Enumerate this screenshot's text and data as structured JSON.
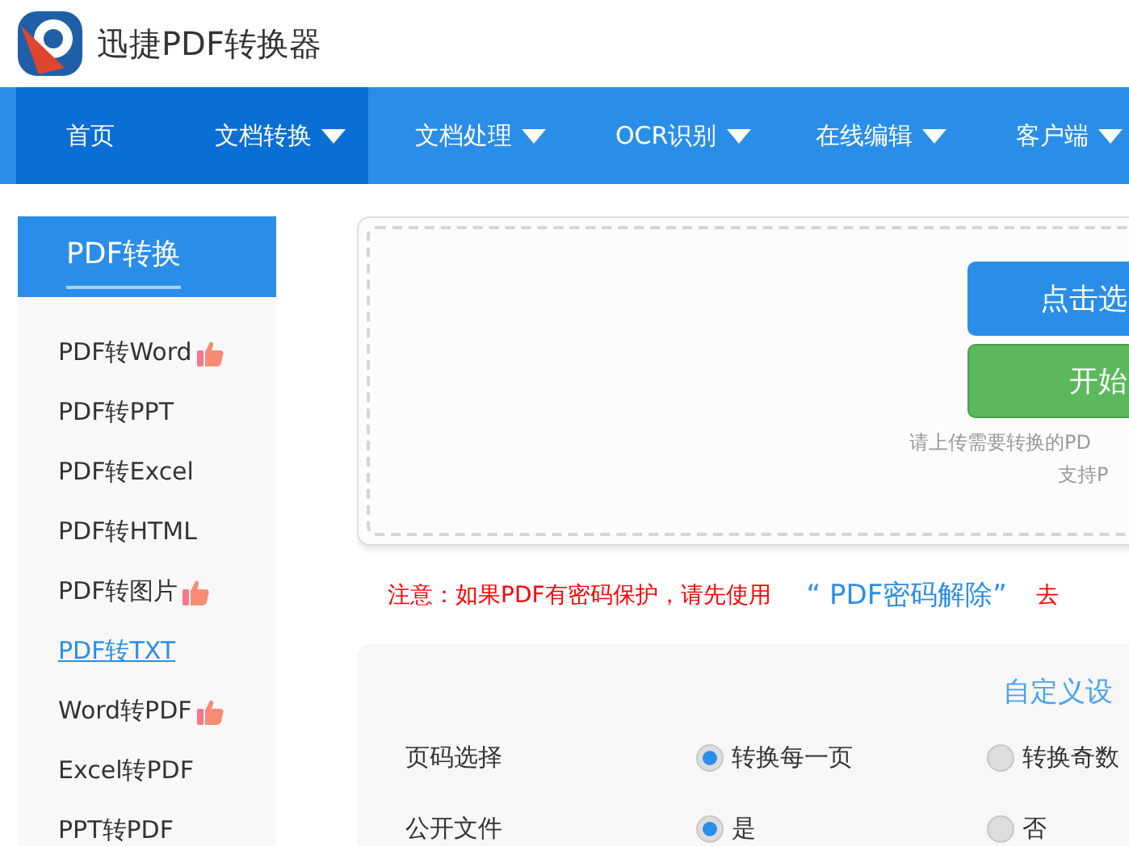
{
  "header": {
    "title": "迅捷PDF转换器"
  },
  "nav": [
    {
      "label": "首页",
      "selected": true,
      "dropdown": false
    },
    {
      "label": "文档转换",
      "selected": true,
      "dropdown": true
    },
    {
      "label": "文档处理",
      "selected": false,
      "dropdown": true
    },
    {
      "label": "OCR识别",
      "selected": false,
      "dropdown": true
    },
    {
      "label": "在线编辑",
      "selected": false,
      "dropdown": true
    },
    {
      "label": "客户端",
      "selected": false,
      "dropdown": true
    }
  ],
  "sidebar": {
    "title": "PDF转换",
    "items": [
      {
        "label": "PDF转Word",
        "selected": false,
        "recommended": true
      },
      {
        "label": "PDF转PPT",
        "selected": false,
        "recommended": false
      },
      {
        "label": "PDF转Excel",
        "selected": false,
        "recommended": false
      },
      {
        "label": "PDF转HTML",
        "selected": false,
        "recommended": false
      },
      {
        "label": "PDF转图片",
        "selected": false,
        "recommended": true
      },
      {
        "label": "PDF转TXT",
        "selected": true,
        "recommended": false
      },
      {
        "label": "Word转PDF",
        "selected": false,
        "recommended": true
      },
      {
        "label": "Excel转PDF",
        "selected": false,
        "recommended": false
      },
      {
        "label": "PPT转PDF",
        "selected": false,
        "recommended": false
      }
    ]
  },
  "upload": {
    "select_button": "点击选",
    "start_button": "开始",
    "hint_lines": [
      "请上传需要转换的PD",
      "支持P"
    ]
  },
  "notice": {
    "text": "注意：如果PDF有密码保护，请先使用",
    "link": "“ PDF密码解除”",
    "tail": "去"
  },
  "settings": {
    "title": "自定义设",
    "rows": [
      {
        "label": "页码选择",
        "options": [
          {
            "label": "转换每一页",
            "selected": true
          },
          {
            "label": "转换奇数",
            "selected": false
          }
        ]
      },
      {
        "label": "公开文件",
        "options": [
          {
            "label": "是",
            "selected": true
          },
          {
            "label": "否",
            "selected": false
          }
        ]
      }
    ]
  }
}
